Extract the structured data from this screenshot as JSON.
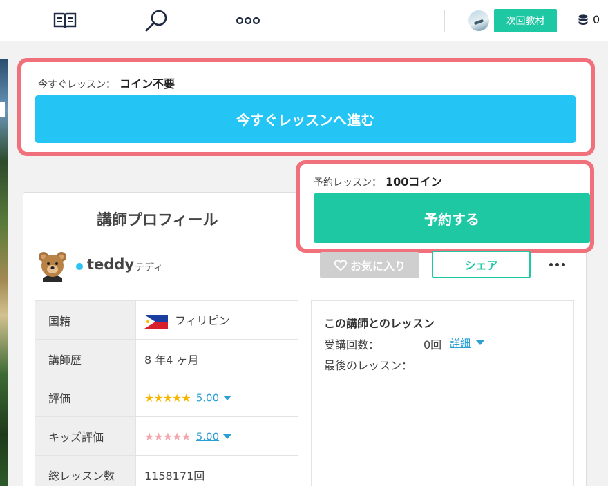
{
  "topbar": {
    "icons": [
      "book-icon",
      "search-icon",
      "more-dots-icon"
    ],
    "next_material_label": "次回教材",
    "coin_count": "0"
  },
  "instant": {
    "label": "今すぐレッスン：",
    "cost": "コイン不要",
    "button": "今すぐレッスンへ進む"
  },
  "reserve": {
    "label": "予約レッスン：",
    "cost": "100コイン",
    "button": "予約する"
  },
  "profile": {
    "title": "講師プロフィール",
    "name": "teddy",
    "name_kana": "テディ",
    "favorite_label": "お気に入り",
    "share_label": "シェア",
    "rows": [
      {
        "key": "国籍",
        "value": "フィリピン"
      },
      {
        "key": "講師歴",
        "value": "8 年4 ヶ月"
      },
      {
        "key": "評価",
        "value": "5.00"
      },
      {
        "key": "キッズ評価",
        "value": "5.00"
      },
      {
        "key": "総レッスン数",
        "value": "1158171回"
      }
    ],
    "rating_star_color": "#f7b500",
    "kids_star_color": "#f4a6ad"
  },
  "lessons": {
    "title": "この講師とのレッスン",
    "count_label": "受講回数：",
    "count_value": "0回",
    "detail_link": "詳細",
    "last_label": "最後のレッスン："
  },
  "colors": {
    "accent_green": "#1ec8a3",
    "accent_blue": "#24c5f4",
    "highlight_red": "#f0707b"
  }
}
